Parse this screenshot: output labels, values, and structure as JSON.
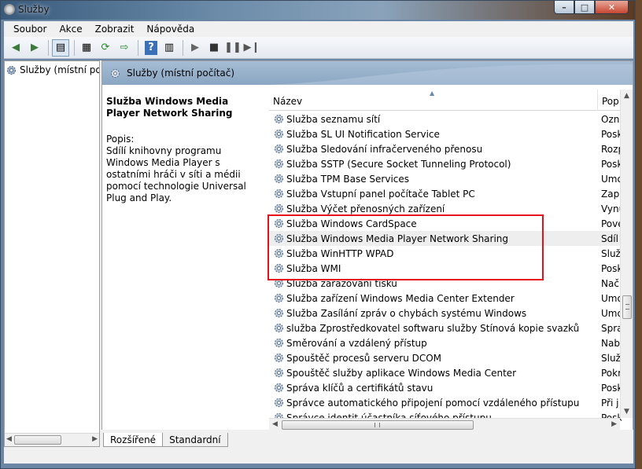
{
  "window": {
    "title": "Služby"
  },
  "menu": [
    "Soubor",
    "Akce",
    "Zobrazit",
    "Nápověda"
  ],
  "tree": {
    "item": "Služby (místní počítač)"
  },
  "main_header": {
    "title": "Služby (místní počítač)"
  },
  "description": {
    "service_name": "Služba Windows Media Player Network Sharing",
    "popis_label": "Popis:",
    "text": "Sdílí knihovny programu Windows Media Player s ostatními hráči v síti a médii pomocí technologie Universal Plug and Play."
  },
  "columns": {
    "name": "Název",
    "pop": "Pop"
  },
  "rows": [
    {
      "name": "Služba seznamu sítí",
      "pop": "Ozna"
    },
    {
      "name": "Služba SL UI Notification Service",
      "pop": "Posk"
    },
    {
      "name": "Služba Sledování infračerveného přenosu",
      "pop": "Rozp"
    },
    {
      "name": "Služba SSTP (Secure Socket Tunneling Protocol)",
      "pop": "Posk"
    },
    {
      "name": "Služba TPM Base Services",
      "pop": "Umo"
    },
    {
      "name": "Služba Vstupní panel počítače Tablet PC",
      "pop": "Zapi"
    },
    {
      "name": "Služba Výčet přenosných zařízení",
      "pop": "Vynu"
    },
    {
      "name": "Služba Windows CardSpace",
      "pop": "Pove"
    },
    {
      "name": "Služba Windows Media Player Network Sharing",
      "pop": "Sdíl"
    },
    {
      "name": "Služba WinHTTP WPAD",
      "pop": "Služ"
    },
    {
      "name": "Služba WMI",
      "pop": "Posk"
    },
    {
      "name": "Služba zařazování tisku",
      "pop": "Nač"
    },
    {
      "name": "Služba zařízení Windows Media Center Extender",
      "pop": "Umo"
    },
    {
      "name": "Služba Zasílání zpráv o chybách systému Windows",
      "pop": "Umo"
    },
    {
      "name": "služba Zprostředkovatel softwaru služby Stínová kopie svazků",
      "pop": "Spra"
    },
    {
      "name": "Směrování a vzdálený přístup",
      "pop": "Nab"
    },
    {
      "name": "Spouštěč procesů serveru DCOM",
      "pop": "Služ"
    },
    {
      "name": "Spouštěč služby aplikace Windows Media Center",
      "pop": "Pokr"
    },
    {
      "name": "Správa klíčů a certifikátů stavu",
      "pop": "Posk"
    },
    {
      "name": "Správce automatického připojení pomocí vzdáleného přístupu",
      "pop": "Při j"
    },
    {
      "name": "Správce identit účastníka síťového přístupu",
      "pop": "Posk"
    }
  ],
  "tabs": {
    "extended": "Rozšířené",
    "standard": "Standardní"
  },
  "colors": {
    "highlight_box": "#e5101a",
    "header_blue": "#8aa6c3"
  }
}
